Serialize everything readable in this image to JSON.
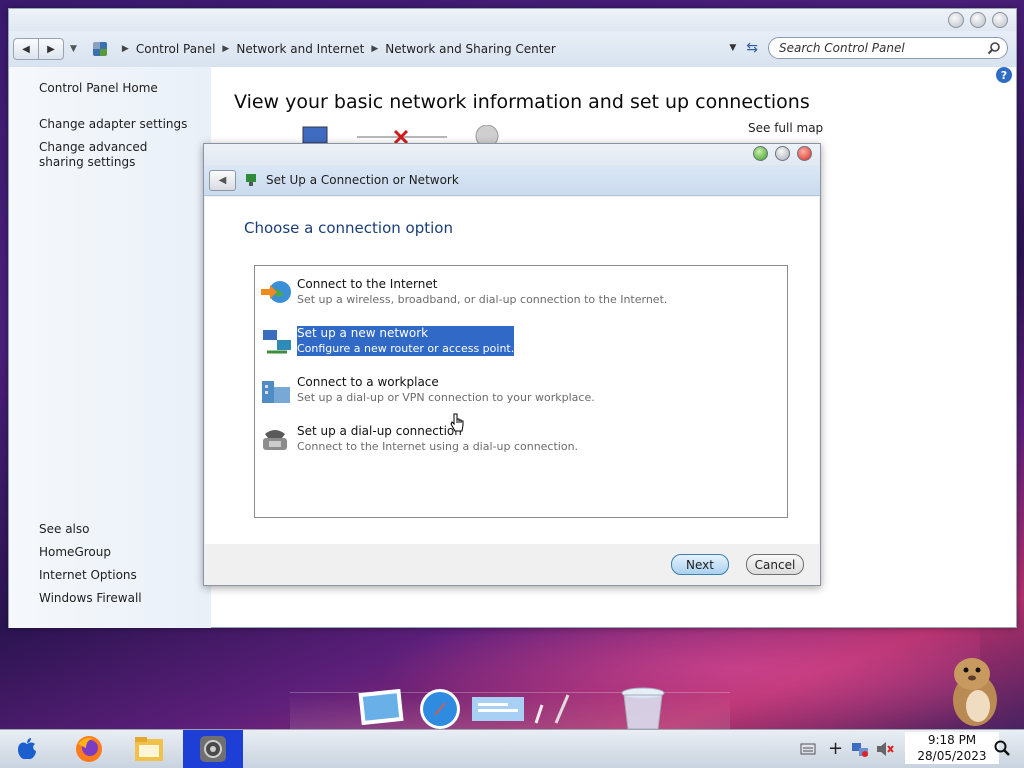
{
  "breadcrumb": [
    "Control Panel",
    "Network and Internet",
    "Network and Sharing Center"
  ],
  "search": {
    "placeholder": "Search Control Panel"
  },
  "sidebar": {
    "items": [
      {
        "label": "Control Panel Home"
      },
      {
        "label": "Change adapter settings"
      },
      {
        "label": "Change advanced sharing settings"
      }
    ],
    "see_also_heading": "See also",
    "see_also": [
      {
        "label": "HomeGroup"
      },
      {
        "label": "Internet Options"
      },
      {
        "label": "Windows Firewall"
      }
    ]
  },
  "main": {
    "heading": "View your basic network information and set up connections",
    "see_full_map": "See full map"
  },
  "dialog": {
    "title": "Set Up a Connection or Network",
    "subtitle": "Choose a connection option",
    "options": [
      {
        "title": "Connect to the Internet",
        "desc": "Set up a wireless, broadband, or dial-up connection to the Internet.",
        "icon": "globe-icon",
        "selected": false
      },
      {
        "title": "Set up a new network",
        "desc": "Configure a new router or access point.",
        "icon": "network-icon",
        "selected": true
      },
      {
        "title": "Connect to a workplace",
        "desc": "Set up a dial-up or VPN connection to your workplace.",
        "icon": "workplace-icon",
        "selected": false
      },
      {
        "title": "Set up a dial-up connection",
        "desc": "Connect to the Internet using a dial-up connection.",
        "icon": "phone-icon",
        "selected": false
      }
    ],
    "next_label": "Next",
    "cancel_label": "Cancel"
  },
  "taskbar": {
    "time": "9:18 PM",
    "date": "28/05/2023"
  },
  "colors": {
    "selection": "#3169c6",
    "heading_blue": "#1a3e78"
  }
}
